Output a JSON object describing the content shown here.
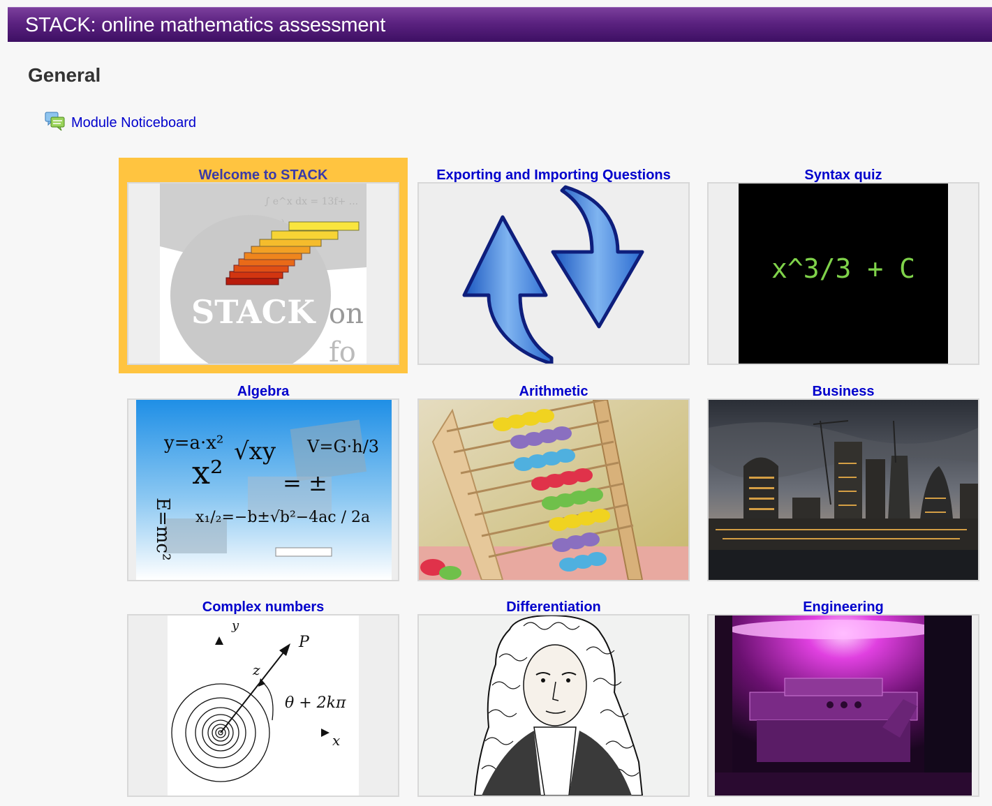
{
  "header": {
    "title": "STACK: online mathematics assessment"
  },
  "section": {
    "title": "General",
    "noticeboard": {
      "label": "Module Noticeboard",
      "icon": "forum-icon"
    }
  },
  "tiles": [
    {
      "title": "Welcome to STACK",
      "highlighted": true,
      "image": "stack-logo",
      "image_text": [
        "STACK",
        "on",
        "fo"
      ]
    },
    {
      "title": "Exporting and Importing Questions",
      "image": "blue-sync-arrows"
    },
    {
      "title": "Syntax quiz",
      "image": "black-screen-formula",
      "image_text": "x^3/3 + C"
    },
    {
      "title": "Algebra",
      "image": "handwritten-formulas",
      "image_text": [
        "y=a·x²",
        "x²",
        "V=G·h/3",
        "E=mc²",
        "x₁/₂=−b±√b²−4ac / 2a"
      ]
    },
    {
      "title": "Arithmetic",
      "image": "abacus-photo"
    },
    {
      "title": "Business",
      "image": "city-skyline-photo"
    },
    {
      "title": "Complex numbers",
      "image": "spiral-diagram",
      "image_text": [
        "y",
        "P",
        "z",
        "θ + 2kπ",
        "x"
      ]
    },
    {
      "title": "Differentiation",
      "image": "newton-portrait"
    },
    {
      "title": "Engineering",
      "image": "purple-plasma-chamber"
    }
  ],
  "colors": {
    "banner": "#5b2280",
    "link": "#0000cc",
    "highlight": "#ffc440",
    "formula_green": "#7fd24a"
  }
}
